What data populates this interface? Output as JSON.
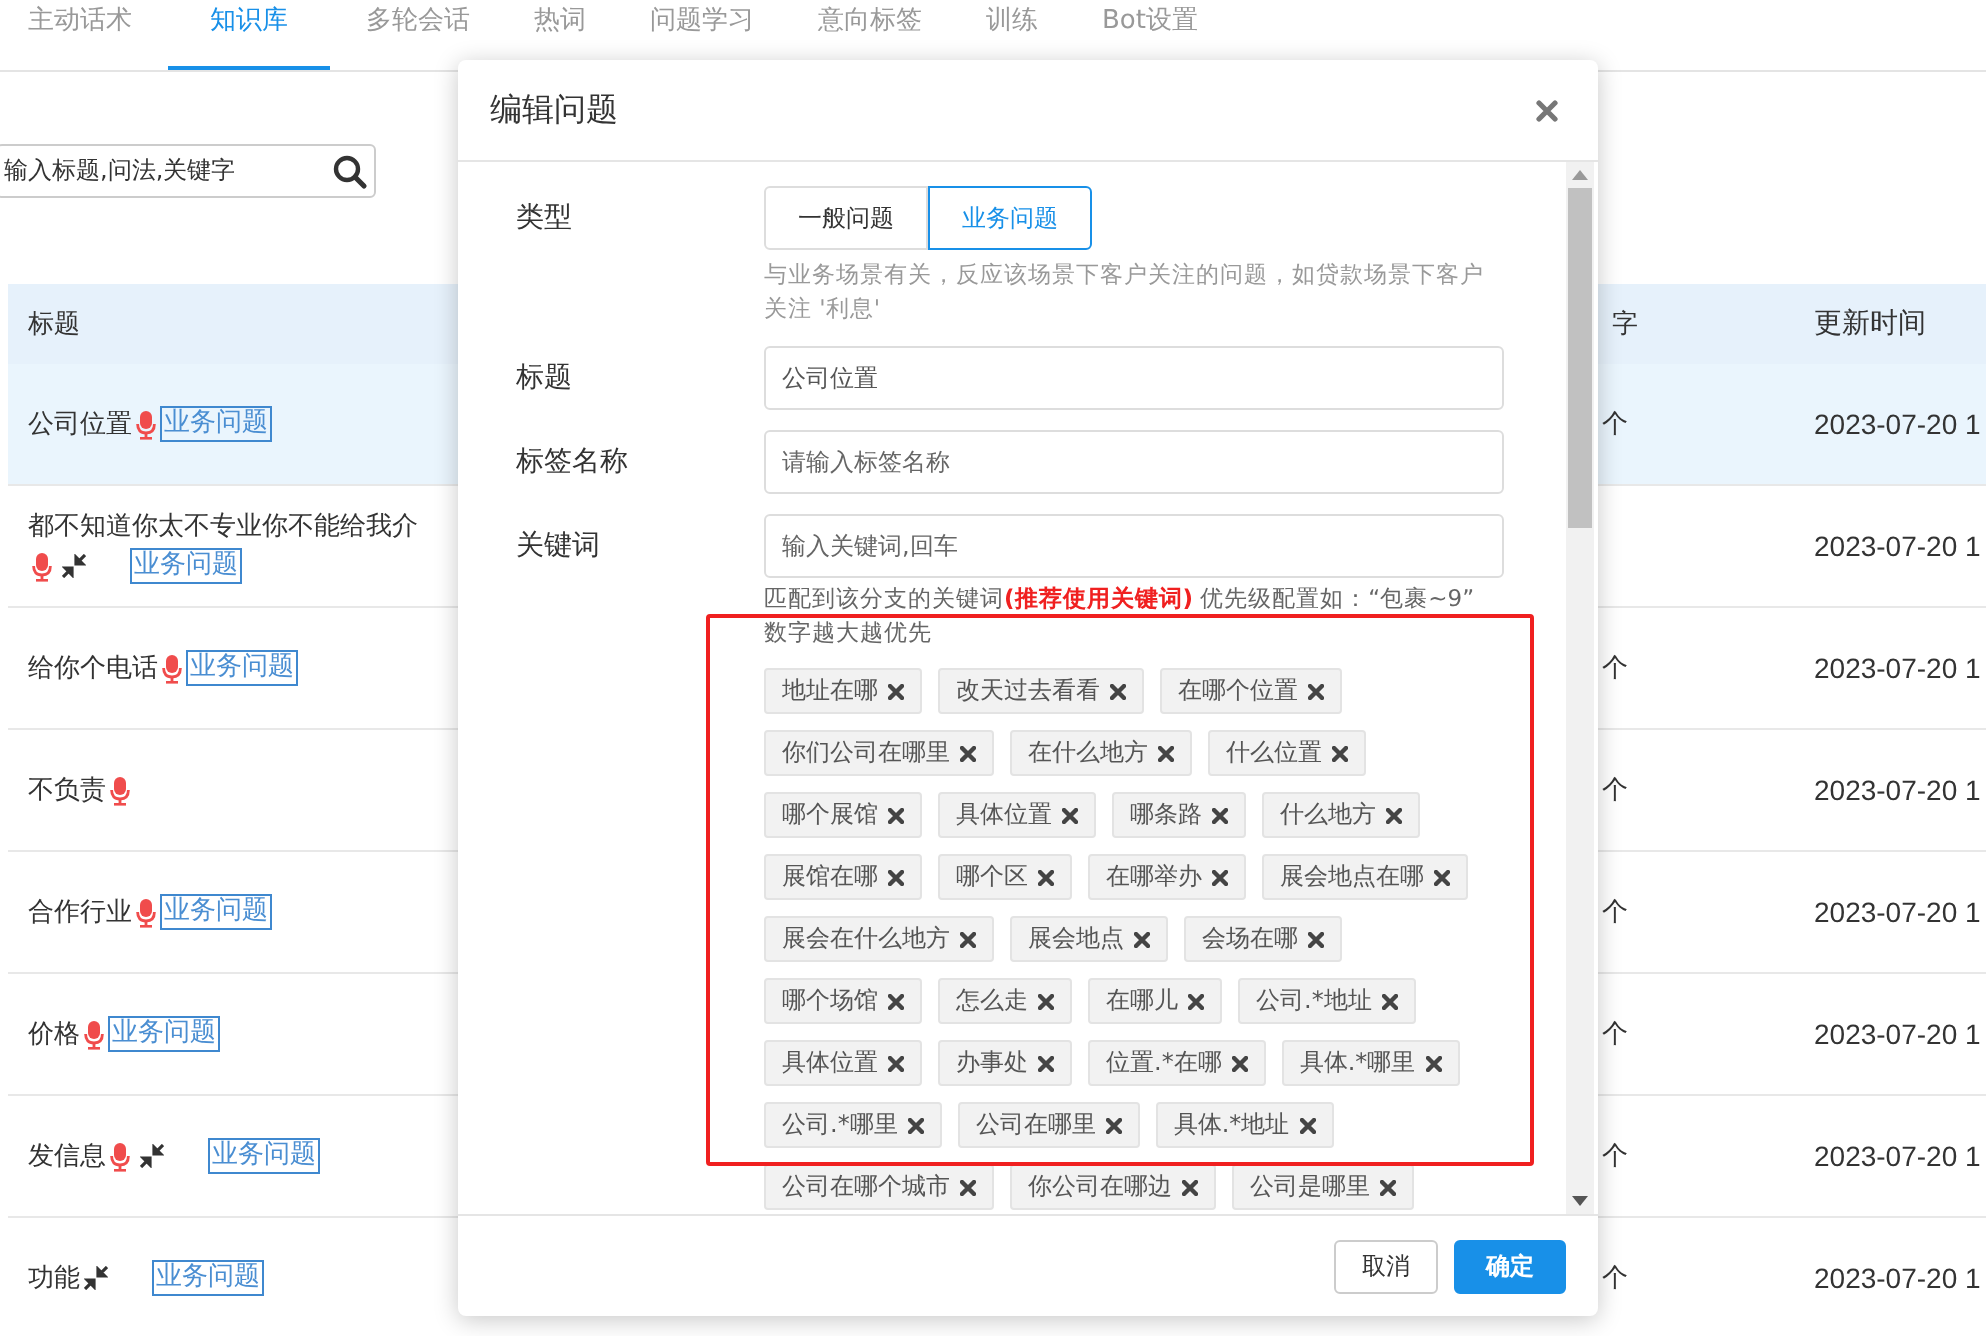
{
  "nav_tabs": [
    {
      "label": "主动话术",
      "selected": false
    },
    {
      "label": "知识库",
      "selected": true
    },
    {
      "label": "多轮会话",
      "selected": false
    },
    {
      "label": "热词",
      "selected": false
    },
    {
      "label": "问题学习",
      "selected": false
    },
    {
      "label": "意向标签",
      "selected": false
    },
    {
      "label": "训练",
      "selected": false
    },
    {
      "label": "Bot设置",
      "selected": false
    }
  ],
  "search": {
    "placeholder": "输入标题,问法,关键字"
  },
  "table": {
    "columns": [
      "标题",
      "字",
      "更新时间"
    ],
    "rows": [
      {
        "title": "公司位置",
        "voice": true,
        "linked": false,
        "tag": "业务问题",
        "keywords": "个",
        "updated": "2023-07-20 1",
        "selected": true
      },
      {
        "title": "都不知道你太不专业你不能给我介",
        "voice": true,
        "linked": true,
        "tag": "业务问题",
        "updated": "2023-07-20 1",
        "selected": false
      },
      {
        "title": "给你个电话",
        "voice": true,
        "linked": false,
        "tag": "业务问题",
        "keywords": "个",
        "updated": "2023-07-20 1",
        "selected": false
      },
      {
        "title": "不负责",
        "voice": true,
        "linked": false,
        "keywords": "个",
        "updated": "2023-07-20 1",
        "selected": false
      },
      {
        "title": "合作行业",
        "voice": true,
        "linked": false,
        "tag": "业务问题",
        "keywords": "个",
        "updated": "2023-07-20 1",
        "selected": false
      },
      {
        "title": "价格",
        "voice": true,
        "linked": false,
        "tag": "业务问题",
        "keywords": "个",
        "updated": "2023-07-20 1",
        "selected": false
      },
      {
        "title": "发信息",
        "voice": true,
        "linked": true,
        "tag": "业务问题",
        "keywords": "个",
        "updated": "2023-07-20 1",
        "selected": false
      },
      {
        "title": "功能",
        "voice": false,
        "linked": true,
        "tag": "业务问题",
        "keywords": "个",
        "updated": "2023-07-20 1",
        "selected": false
      }
    ]
  },
  "dialog": {
    "title": "编辑问题",
    "type": {
      "label": "类型",
      "options": [
        {
          "label": "一般问题",
          "selected": false
        },
        {
          "label": "业务问题",
          "selected": true
        }
      ],
      "hint": "与业务场景有关，反应该场景下客户关注的问题，如贷款场景下客户关注 '利息'"
    },
    "title_field": {
      "label": "标题",
      "value": "公司位置"
    },
    "tag_field": {
      "label": "标签名称",
      "placeholder": "请输入标签名称"
    },
    "keyword_field": {
      "label": "关键词",
      "placeholder": "输入关键词,回车",
      "hint": "匹配到该分支的关键词**(推荐使用关键词)** 优先级配置如：“包裹~9” 数字越大越优先"
    },
    "keywords": [
      "地址在哪",
      "改天过去看看",
      "在哪个位置",
      "你们公司在哪里",
      "在什么地方",
      "什么位置",
      "哪个展馆",
      "具体位置",
      "哪条路",
      "什么地方",
      "展馆在哪",
      "哪个区",
      "在哪举办",
      "展会地点在哪",
      "展会在什么地方",
      "展会地点",
      "会场在哪",
      "哪个场馆",
      "怎么走",
      "在哪儿",
      "公司.*地址",
      "具体位置",
      "办事处",
      "位置.*在哪",
      "具体.*哪里",
      "公司.*哪里",
      "公司在哪里",
      "具体.*地址",
      "公司在哪个城市",
      "你公司在哪边",
      "公司是哪里"
    ],
    "buttons": [
      {
        "label": "取消",
        "kind": "secondary"
      },
      {
        "label": "确定",
        "kind": "primary"
      }
    ]
  }
}
